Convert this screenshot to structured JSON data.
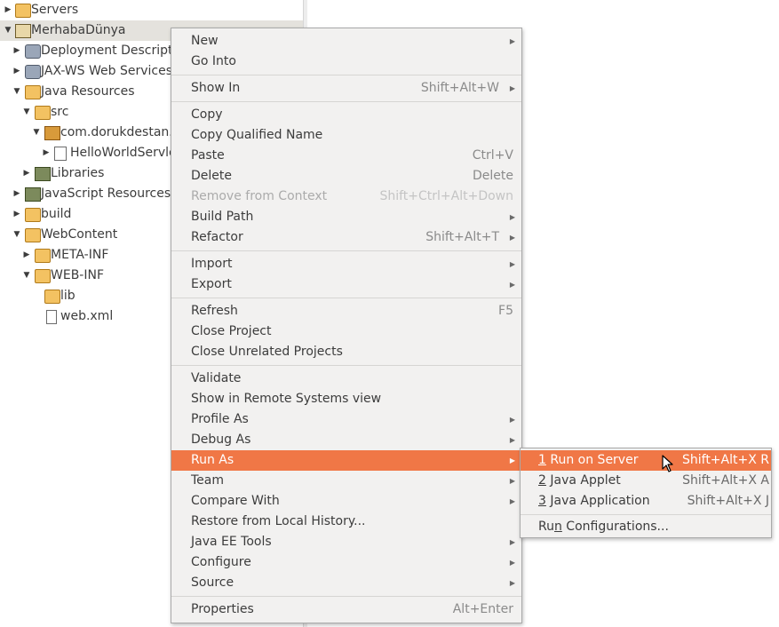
{
  "tree": {
    "items": [
      {
        "label": "Servers"
      },
      {
        "label": "MerhabaDünya"
      },
      {
        "label": "Deployment Descripto"
      },
      {
        "label": "JAX-WS Web Services"
      },
      {
        "label": "Java Resources"
      },
      {
        "label": "src"
      },
      {
        "label": "com.dorukdestan."
      },
      {
        "label": "HelloWorldServle"
      },
      {
        "label": "Libraries"
      },
      {
        "label": "JavaScript Resources"
      },
      {
        "label": "build"
      },
      {
        "label": "WebContent"
      },
      {
        "label": "META-INF"
      },
      {
        "label": "WEB-INF"
      },
      {
        "label": "lib"
      },
      {
        "label": "web.xml"
      }
    ]
  },
  "context_menu": {
    "items": [
      {
        "label": "New"
      },
      {
        "label": "Go Into"
      },
      {
        "label": "Show In",
        "shortcut": "Shift+Alt+W"
      },
      {
        "label": "Copy"
      },
      {
        "label": "Copy Qualified Name"
      },
      {
        "label": "Paste",
        "shortcut": "Ctrl+V"
      },
      {
        "label": "Delete",
        "shortcut": "Delete"
      },
      {
        "label": "Remove from Context",
        "shortcut": "Shift+Ctrl+Alt+Down"
      },
      {
        "label": "Build Path"
      },
      {
        "label": "Refactor",
        "shortcut": "Shift+Alt+T"
      },
      {
        "label": "Import"
      },
      {
        "label": "Export"
      },
      {
        "label": "Refresh",
        "shortcut": "F5"
      },
      {
        "label": "Close Project"
      },
      {
        "label": "Close Unrelated Projects"
      },
      {
        "label": "Validate"
      },
      {
        "label": "Show in Remote Systems view"
      },
      {
        "label": "Profile As"
      },
      {
        "label": "Debug As"
      },
      {
        "label": "Run As"
      },
      {
        "label": "Team"
      },
      {
        "label": "Compare With"
      },
      {
        "label": "Restore from Local History..."
      },
      {
        "label": "Java EE Tools"
      },
      {
        "label": "Configure"
      },
      {
        "label": "Source"
      },
      {
        "label": "Properties",
        "shortcut": "Alt+Enter"
      }
    ]
  },
  "run_as_submenu": {
    "items": [
      {
        "mnemonic": "1",
        "label": " Run on Server",
        "shortcut": "Shift+Alt+X R"
      },
      {
        "mnemonic": "2",
        "label": " Java Applet",
        "shortcut": "Shift+Alt+X A"
      },
      {
        "mnemonic": "3",
        "label": " Java Application",
        "shortcut": "Shift+Alt+X J"
      },
      {
        "pre": "Ru",
        "mnemonic": "n",
        "post": " Configurations..."
      }
    ]
  },
  "colors": {
    "highlight": "#f07746",
    "menu_background": "#f2f1f0",
    "selected_row": "#e4e2dd"
  }
}
